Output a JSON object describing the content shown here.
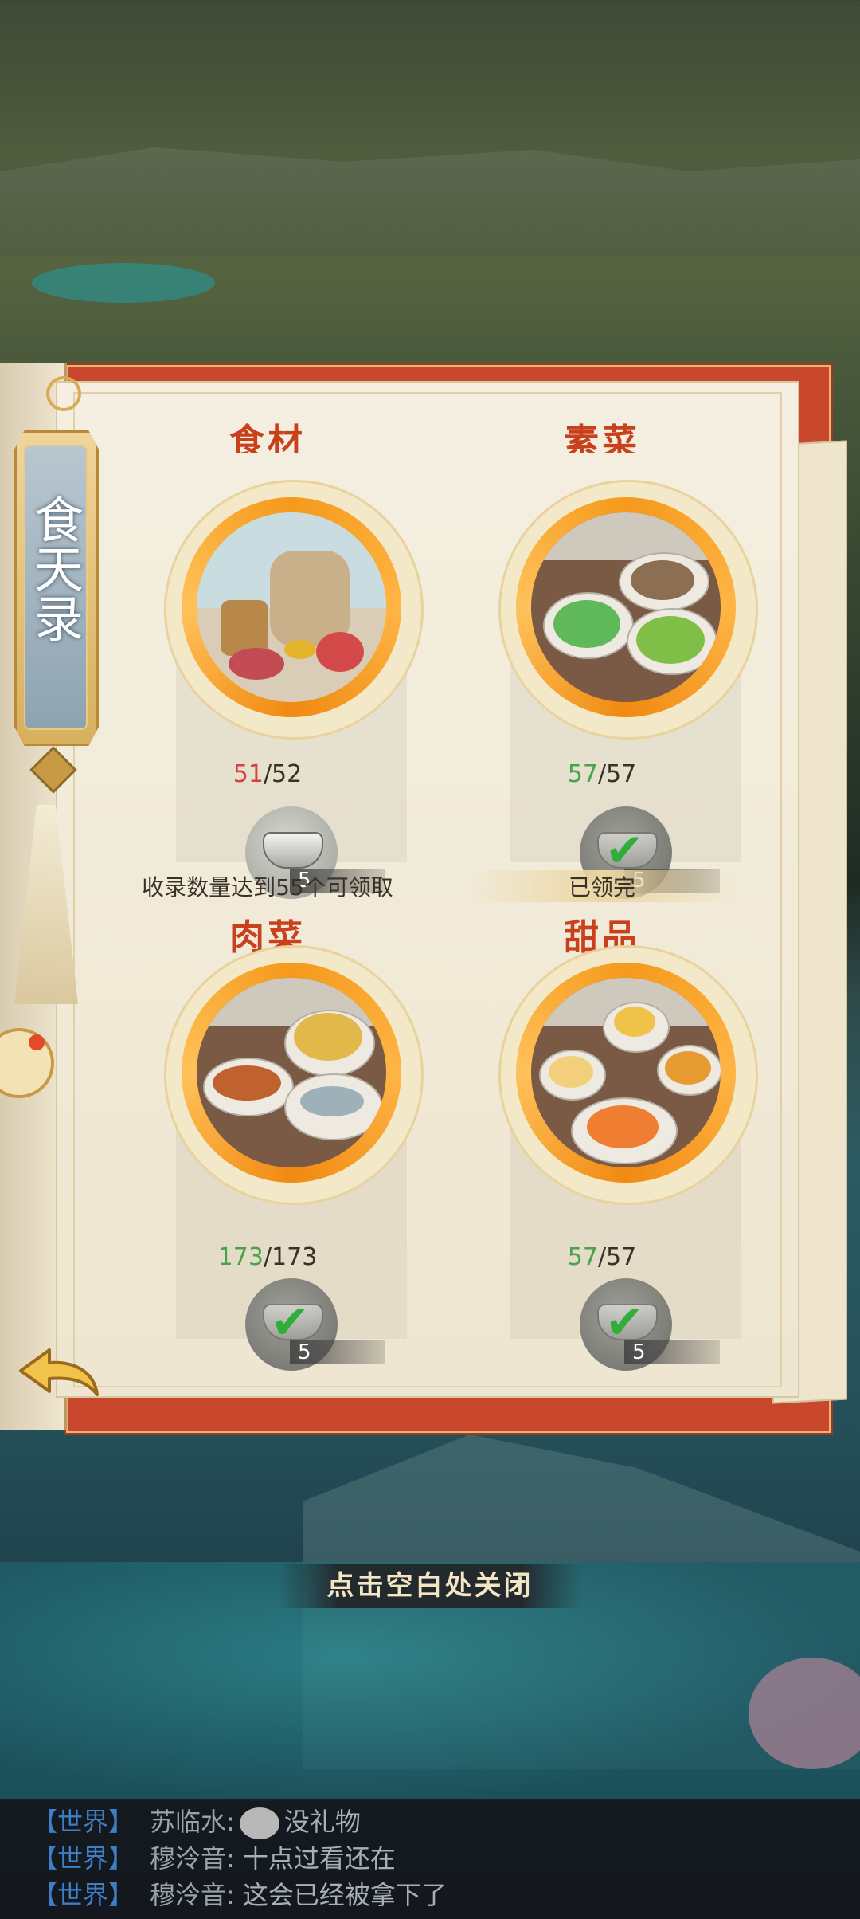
{
  "ribbon": {
    "title": "食天录"
  },
  "categories": [
    {
      "label": "食材",
      "collected": "51",
      "total": "/52",
      "reward_qty": "5",
      "note": "收录数量达到55个可领取"
    },
    {
      "label": "素菜",
      "collected": "57",
      "total": "/57",
      "reward_qty": "5",
      "note": "已领完"
    },
    {
      "label": "肉菜",
      "collected": "173",
      "total": "/173",
      "reward_qty": "5"
    },
    {
      "label": "甜品",
      "collected": "57",
      "total": "/57",
      "reward_qty": "5"
    }
  ],
  "close_hint": "点击空白处关闭",
  "chat": [
    {
      "channel": "【世界】",
      "sender": "苏临水:",
      "message": "没礼物"
    },
    {
      "channel": "【世界】",
      "sender": "穆泠音:",
      "message": "十点过看还在"
    },
    {
      "channel": "【世界】",
      "sender": "穆泠音:",
      "message": "这会已经被拿下了"
    }
  ],
  "colors": {
    "accent_orange": "#f59a1c",
    "label_red": "#c8411c",
    "collected_incomplete": "#d94040",
    "collected_complete": "#4aa24a",
    "chat_channel": "#3f7fc8"
  },
  "icons": [
    "back-arrow-icon",
    "silver-ingot-icon",
    "checkmark-icon",
    "chat-emoji-icon"
  ]
}
